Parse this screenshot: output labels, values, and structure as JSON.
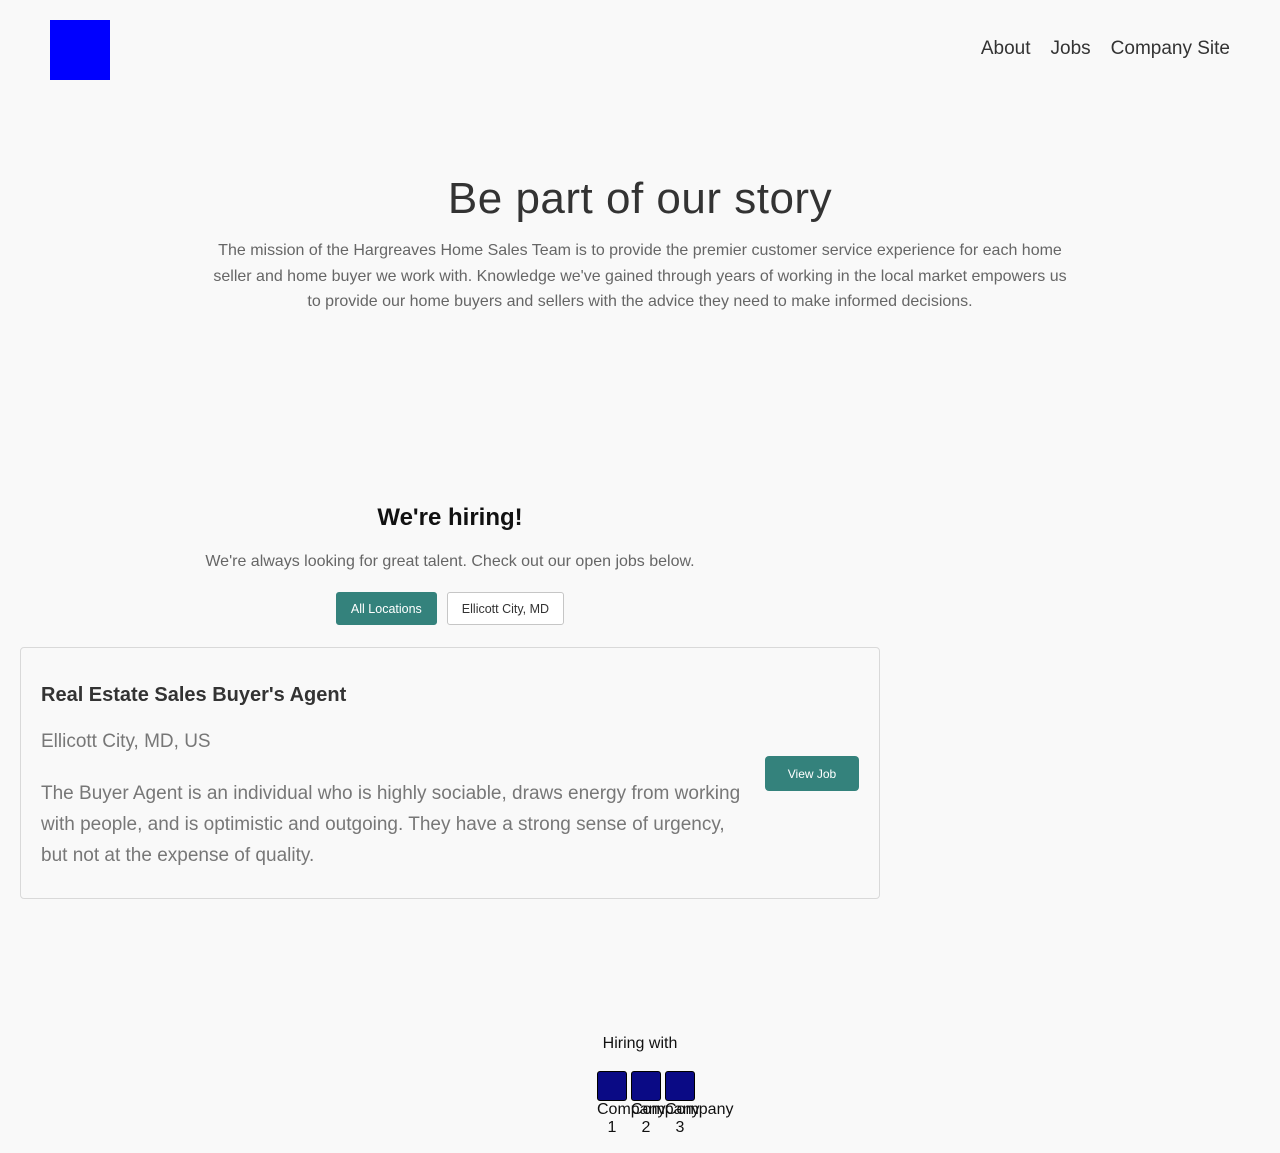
{
  "header": {
    "logo_color": "#0000ff",
    "nav": [
      "About",
      "Jobs",
      "Company Site"
    ]
  },
  "hero": {
    "title": "Be part of our story",
    "text": "The mission of the Hargreaves Home Sales Team is to provide the premier customer service experience for each home seller and home buyer we work with. Knowledge we've gained through years of working in the local market empowers us to provide our home buyers and sellers with the advice they need to make informed decisions."
  },
  "hiring": {
    "title": "We're hiring!",
    "subtitle": "We're always looking for great talent. Check out our open jobs below.",
    "filters": [
      "All Locations",
      "Ellicott City, MD"
    ],
    "accent": "#34827c"
  },
  "job": {
    "title": "Real Estate Sales Buyer's Agent",
    "location": "Ellicott City, MD, US",
    "description": "The Buyer Agent is an individual who is highly sociable, draws energy from working with people, and is optimistic and outgoing. They have a strong sense of urgency, but not at the expense of quality.",
    "button": "View Job"
  },
  "footer": {
    "label": "Hiring with",
    "partners": [
      "Company 1",
      "Company 2",
      "Company 3"
    ]
  }
}
